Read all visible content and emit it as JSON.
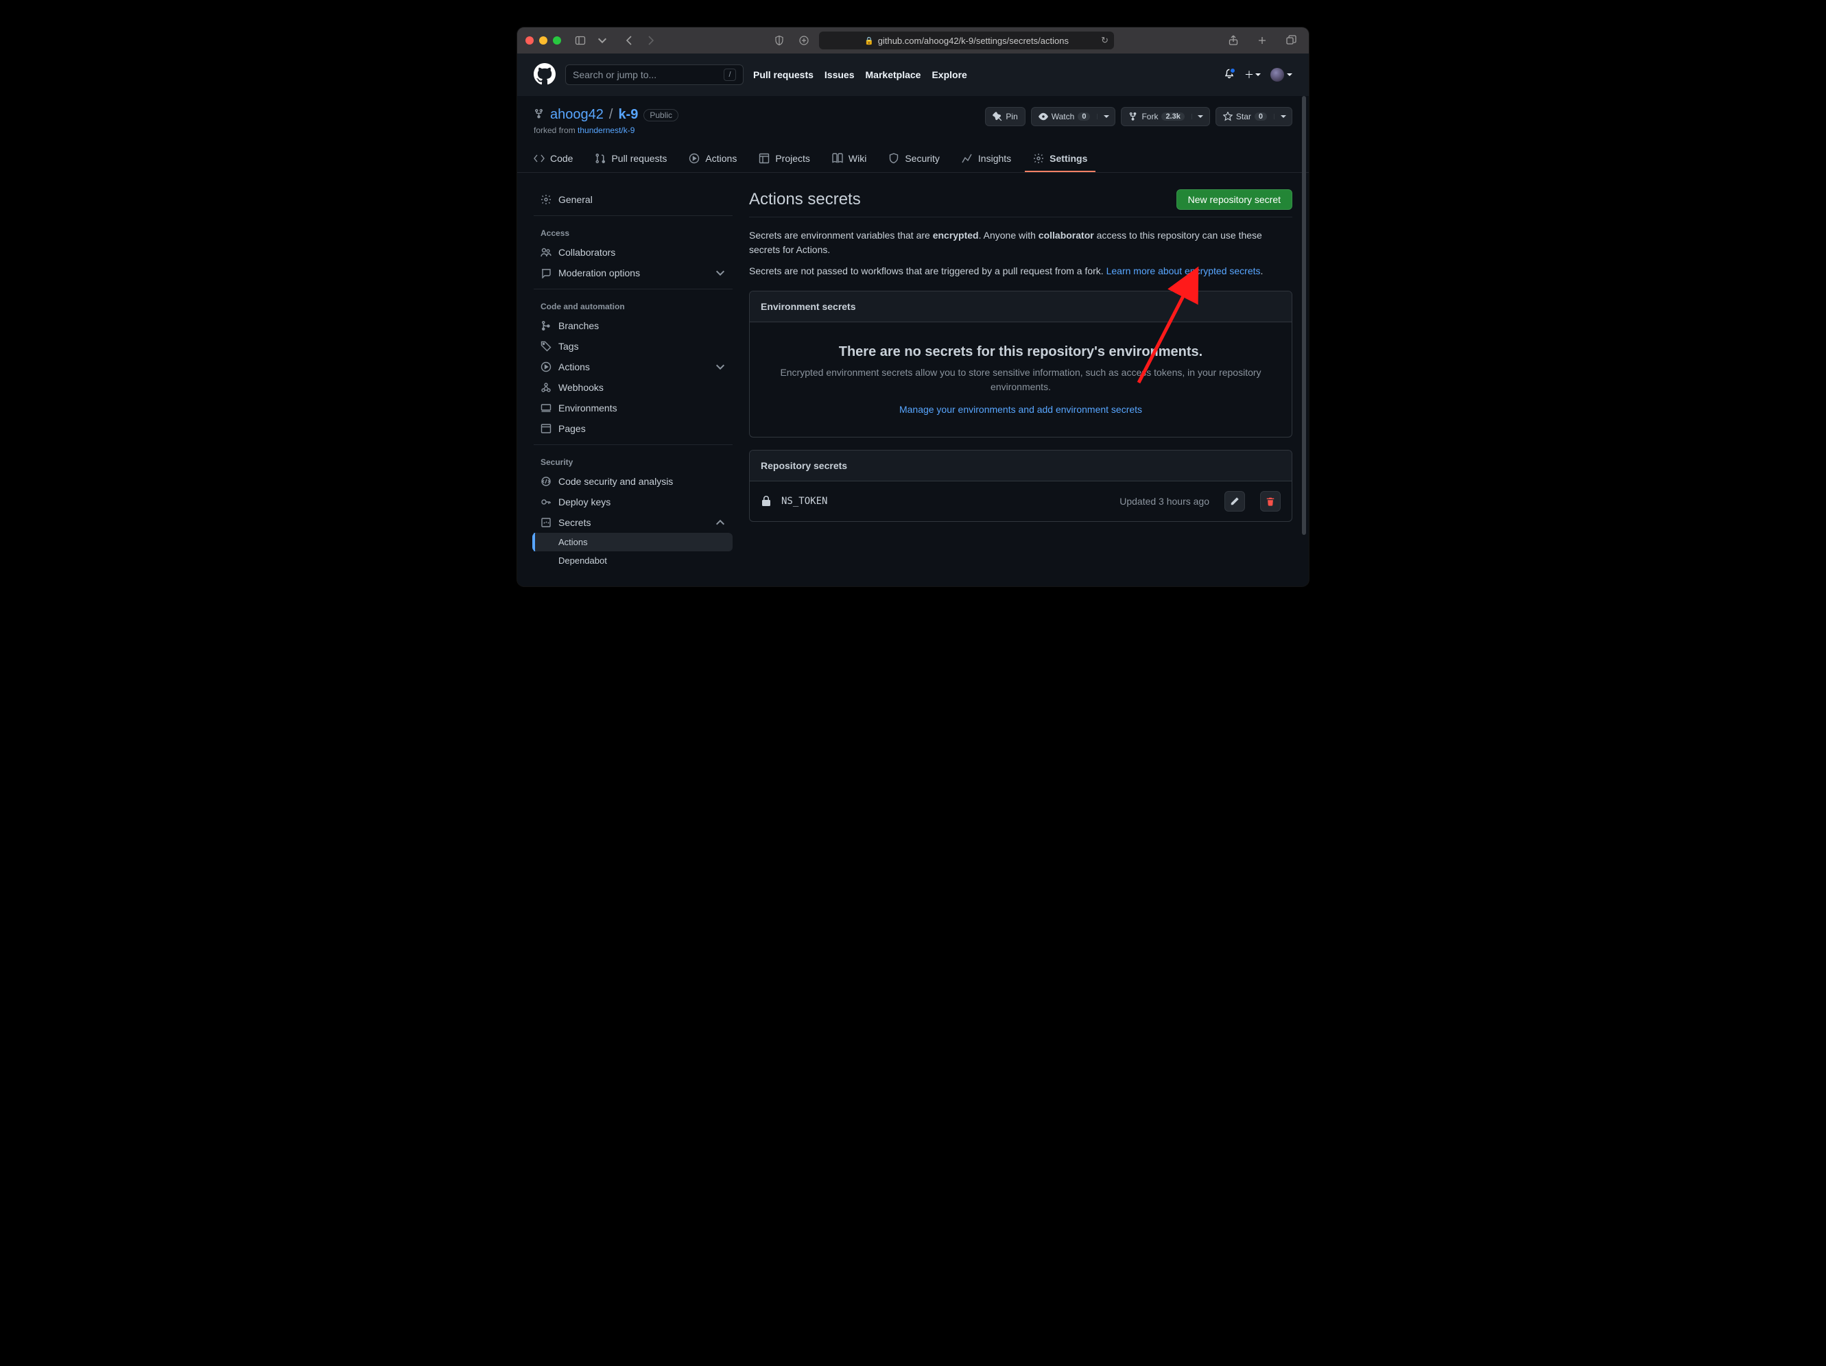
{
  "browser": {
    "url": "github.com/ahoog42/k-9/settings/secrets/actions"
  },
  "gh_header": {
    "search_placeholder": "Search or jump to...",
    "nav": [
      "Pull requests",
      "Issues",
      "Marketplace",
      "Explore"
    ]
  },
  "repo": {
    "owner": "ahoog42",
    "name": "k-9",
    "visibility": "Public",
    "forked_prefix": "forked from ",
    "forked_from": "thundernest/k-9",
    "actions": {
      "pin": "Pin",
      "watch": "Watch",
      "watch_count": "0",
      "fork": "Fork",
      "fork_count": "2.3k",
      "star": "Star",
      "star_count": "0"
    },
    "tabs": [
      "Code",
      "Pull requests",
      "Actions",
      "Projects",
      "Wiki",
      "Security",
      "Insights",
      "Settings"
    ]
  },
  "sidebar": {
    "general": "General",
    "groups": [
      {
        "title": "Access",
        "items": [
          {
            "label": "Collaborators"
          },
          {
            "label": "Moderation options",
            "chevron": true
          }
        ]
      },
      {
        "title": "Code and automation",
        "items": [
          {
            "label": "Branches"
          },
          {
            "label": "Tags"
          },
          {
            "label": "Actions",
            "chevron": true
          },
          {
            "label": "Webhooks"
          },
          {
            "label": "Environments"
          },
          {
            "label": "Pages"
          }
        ]
      },
      {
        "title": "Security",
        "items": [
          {
            "label": "Code security and analysis"
          },
          {
            "label": "Deploy keys"
          },
          {
            "label": "Secrets",
            "chevron": true,
            "expanded": true,
            "sub": [
              {
                "label": "Actions",
                "active": true
              },
              {
                "label": "Dependabot"
              }
            ]
          }
        ]
      }
    ]
  },
  "main": {
    "title": "Actions secrets",
    "new_secret_btn": "New repository secret",
    "p1_a": "Secrets are environment variables that are ",
    "p1_b": "encrypted",
    "p1_c": ". Anyone with ",
    "p1_d": "collaborator",
    "p1_e": " access to this repository can use these secrets for Actions.",
    "p2_a": "Secrets are not passed to workflows that are triggered by a pull request from a fork. ",
    "p2_link": "Learn more about encrypted secrets",
    "p2_b": ".",
    "env_box_title": "Environment secrets",
    "env_empty_title": "There are no secrets for this repository's environments.",
    "env_empty_desc": "Encrypted environment secrets allow you to store sensitive information, such as access tokens, in your repository environments.",
    "env_link": "Manage your environments and add environment secrets",
    "repo_box_title": "Repository secrets",
    "secret": {
      "name": "NS_TOKEN",
      "updated": "Updated 3 hours ago"
    }
  }
}
